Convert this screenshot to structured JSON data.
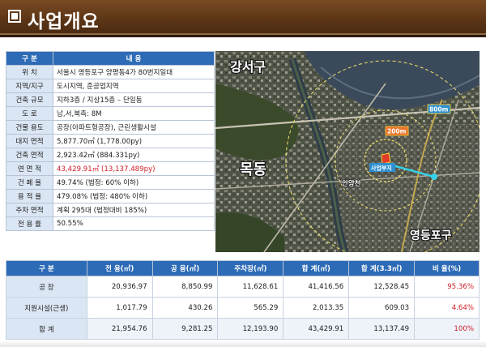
{
  "header": {
    "title": "사업개요"
  },
  "info_table": {
    "headers": [
      "구 분",
      "내 용"
    ],
    "rows": [
      {
        "label": "위 치",
        "value": "서울시 영등포구 양평동4가 80번지일대",
        "highlight": false
      },
      {
        "label": "지역/지구",
        "value": "도시지역, 준공업지역",
        "highlight": false
      },
      {
        "label": "건축 규모",
        "value": "지하3층 / 지상15층 – 단일동",
        "highlight": false
      },
      {
        "label": "도 로",
        "value": "남,서,북측: 8M",
        "highlight": false
      },
      {
        "label": "건물 용도",
        "value": "공장(아파트형공장), 근린생활시설",
        "highlight": false
      },
      {
        "label": "대지 면적",
        "value": "5,877.70㎡ (1,778.00py)",
        "highlight": false
      },
      {
        "label": "건축 면적",
        "value": "2,923.42㎡ (884.331py)",
        "highlight": false
      },
      {
        "label": "연 면 적",
        "value": "43,429.91㎡ (13,137.489py)",
        "highlight": true
      },
      {
        "label": "건 폐 율",
        "value": "49.74% (법정: 60% 이하)",
        "highlight": false
      },
      {
        "label": "용 적 율",
        "value": "479.08% (법정: 480% 이하)",
        "highlight": false
      },
      {
        "label": "주차 면적",
        "value": "계획 295대 (법정대비 185%)",
        "highlight": false
      },
      {
        "label": "전 용 률",
        "value": "50.55%",
        "highlight": false
      }
    ]
  },
  "map": {
    "labels": {
      "gangseo": "강서구",
      "mokdong": "목동",
      "yeongdeungpo": "영등포구",
      "yangpyeong": "안양천",
      "site": "사업부지",
      "r200": "200m",
      "r800": "800m"
    }
  },
  "area_table": {
    "headers": [
      "구 분",
      "전 용(㎡)",
      "공 용(㎡)",
      "주차장(㎡)",
      "합 계(㎡)",
      "합 계(3.3㎡)",
      "비 율(%)"
    ],
    "rows": [
      {
        "label": "공 장",
        "values": [
          "20,936.97",
          "8,850.99",
          "11,628.61",
          "41,416.56",
          "12,528.45",
          "95.36%"
        ]
      },
      {
        "label": "지원시설(근생)",
        "values": [
          "1,017.79",
          "430.26",
          "565.29",
          "2,013.35",
          "609.03",
          "4.64%"
        ]
      },
      {
        "label": "합 계",
        "values": [
          "21,954.76",
          "9,281.25",
          "12,193.90",
          "43,429.91",
          "13,137.49",
          "100%"
        ]
      }
    ]
  }
}
